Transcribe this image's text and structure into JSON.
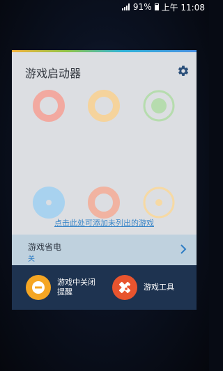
{
  "status_bar": {
    "battery_percent": "91%",
    "time": "上午 11:08"
  },
  "panel": {
    "title": "游戏启动器",
    "settings_icon": "gear-icon",
    "add_games_link": "点击此处可添加未列出的游戏",
    "game_power_saving": {
      "label": "游戏省电",
      "value": "关"
    },
    "tools": [
      {
        "label": "游戏中关闭提醒",
        "icon": "minus-circle-icon",
        "color": "#f5a623"
      },
      {
        "label": "游戏工具",
        "icon": "gamepad-icon",
        "color": "#e8542e"
      }
    ]
  },
  "colors": {
    "accent_blue": "#2f7dc4",
    "panel_bg": "#dcdee2",
    "tools_bg": "#1e3350"
  },
  "game_placeholders": [
    {
      "name": "ring-icon-pink",
      "color": "#f2a9a0"
    },
    {
      "name": "ring-icon-yellow",
      "color": "#f5d39c"
    },
    {
      "name": "target-icon-green",
      "color": "#b6dcae"
    },
    {
      "name": "dot-icon-blue",
      "color": "#a8d2ef"
    },
    {
      "name": "ring-icon-salmon",
      "color": "#f1b3a1"
    },
    {
      "name": "target-icon-yellow",
      "color": "#f6d9a4"
    }
  ]
}
